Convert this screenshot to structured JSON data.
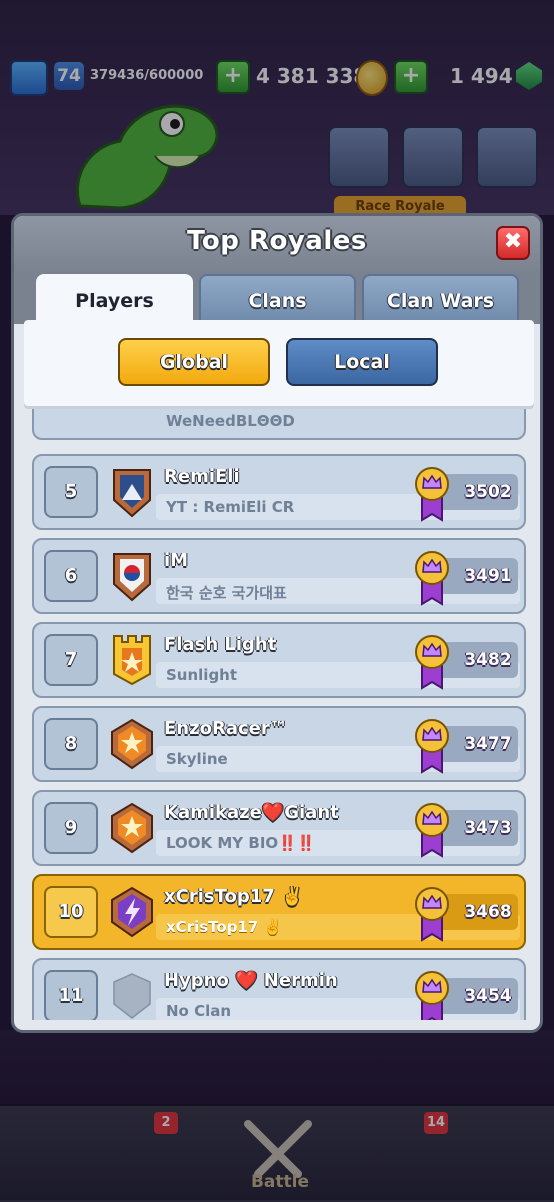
{
  "header": {
    "level": "74",
    "xp": "379436/600000",
    "gold": "4 381 338",
    "gems": "1 494",
    "plus": "+"
  },
  "event_tag": "Race Royale",
  "modal": {
    "title": "Top Royales",
    "close_label": "✖",
    "tabs": [
      {
        "label": "Players",
        "active": true
      },
      {
        "label": "Clans",
        "active": false
      },
      {
        "label": "Clan Wars",
        "active": false
      }
    ],
    "filters": {
      "global": "Global",
      "local": "Local",
      "selected": "Global"
    }
  },
  "leaderboard": {
    "partial_clan": "WeNeedBLΘΘD",
    "rows": [
      {
        "rank": "5",
        "name": "RemiEli",
        "clan": "YT : RemiEli CR",
        "trophies": "3502",
        "badge": "blue-mountain",
        "highlight": false
      },
      {
        "rank": "6",
        "name": "iM",
        "clan": "한국 순호 국가대표",
        "trophies": "3491",
        "badge": "korea-flag",
        "highlight": false
      },
      {
        "rank": "7",
        "name": "Flash Light",
        "clan": "Sunlight",
        "trophies": "3482",
        "badge": "gold-tower",
        "highlight": false
      },
      {
        "rank": "8",
        "name": "EnzoRacer™",
        "clan": "Skyline",
        "trophies": "3477",
        "badge": "orange-star",
        "highlight": false
      },
      {
        "rank": "9",
        "name": "Kamikaze❤️Giant",
        "clan": "LOOK MY BIO‼️‼️",
        "trophies": "3473",
        "badge": "orange-star",
        "highlight": false
      },
      {
        "rank": "10",
        "name": "xCrisTop17 ✌️",
        "clan": "xCrisTop17 ✌️",
        "trophies": "3468",
        "badge": "purple-bolt",
        "highlight": true
      },
      {
        "rank": "11",
        "name": "Hypno ❤️ Nermin",
        "clan": "No Clan",
        "trophies": "3454",
        "badge": "empty-shield",
        "highlight": false
      }
    ]
  },
  "nav": {
    "battle_label": "Battle",
    "cards_badge": "2",
    "clan_badge": "14"
  },
  "colors": {
    "highlight_row": "#f3b62a",
    "normal_row": "#c9d6e5",
    "global_button": "#f2a90f",
    "local_button": "#3b67a3",
    "close_button": "#d22a2a"
  }
}
